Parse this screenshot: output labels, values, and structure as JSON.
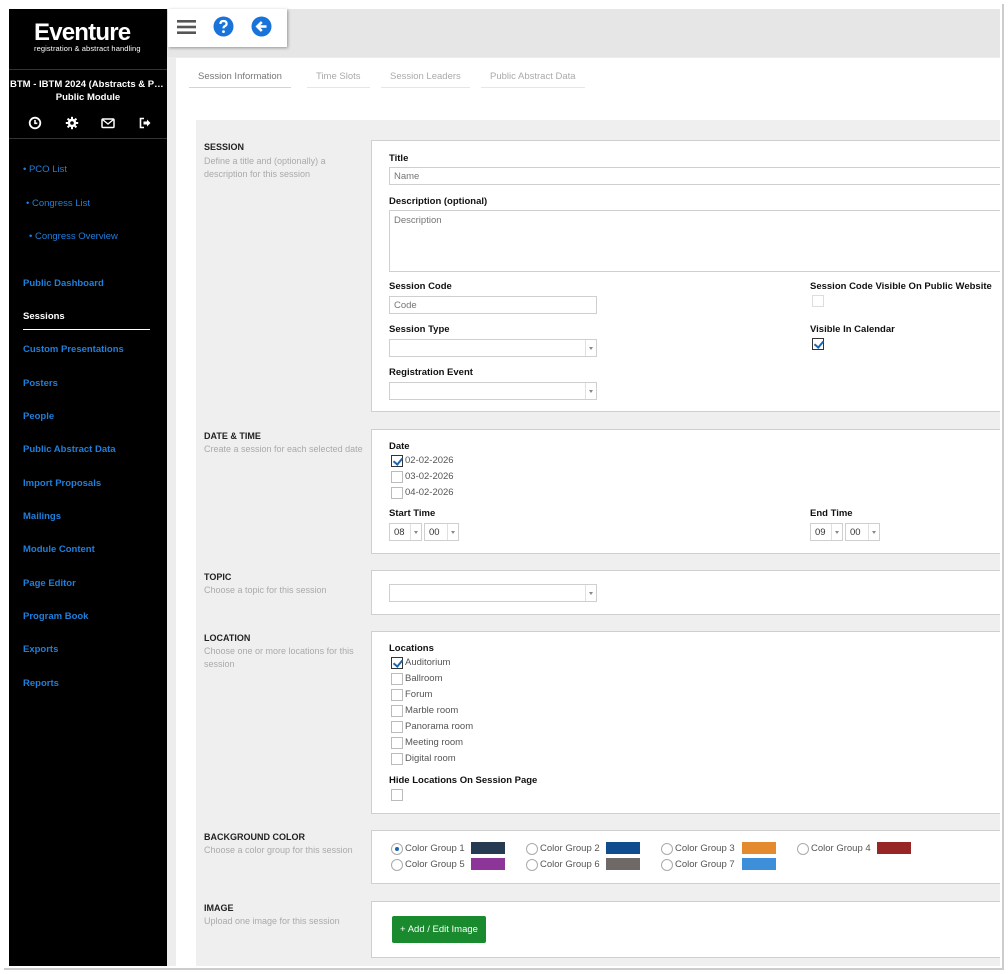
{
  "sidebar": {
    "brand": "Eventure",
    "tagline": "registration & abstract handling",
    "event_title": "BTM - IBTM 2024 (Abstracts & Par...",
    "module": "Public Module",
    "icons": [
      "clock-icon",
      "gear-icon",
      "envelope-icon",
      "logout-icon"
    ],
    "nav": [
      {
        "label": "• PCO List",
        "type": "sub"
      },
      {
        "label": "• Congress List",
        "type": "sub"
      },
      {
        "label": "• Congress Overview",
        "type": "sub"
      },
      {
        "label": "Public Dashboard",
        "type": "main"
      },
      {
        "label": "Sessions",
        "type": "active"
      },
      {
        "label": "Custom Presentations",
        "type": "main"
      },
      {
        "label": "Posters",
        "type": "main"
      },
      {
        "label": "People",
        "type": "main"
      },
      {
        "label": "Public Abstract Data",
        "type": "main"
      },
      {
        "label": "Import Proposals",
        "type": "main"
      },
      {
        "label": "Mailings",
        "type": "main"
      },
      {
        "label": "Module Content",
        "type": "main"
      },
      {
        "label": "Page Editor",
        "type": "main"
      },
      {
        "label": "Program Book",
        "type": "main"
      },
      {
        "label": "Exports",
        "type": "main"
      },
      {
        "label": "Reports",
        "type": "main"
      }
    ]
  },
  "toolbar": {
    "icons": [
      "menu-icon",
      "help-icon",
      "back-icon"
    ],
    "accent": "#1a73d9"
  },
  "tabs": [
    "Session Information",
    "Time Slots",
    "Session Leaders",
    "Public Abstract Data"
  ],
  "session": {
    "title": "SESSION",
    "desc": "Define a title and (optionally) a description for this session",
    "title_label": "Title",
    "title_placeholder": "Name",
    "description_label": "Description (optional)",
    "description_placeholder": "Description",
    "code_label": "Session Code",
    "code_placeholder": "Code",
    "code_visible_label": "Session Code Visible On Public Website",
    "code_visible": false,
    "type_label": "Session Type",
    "type_value": "",
    "calendar_label": "Visible In Calendar",
    "calendar_visible": true,
    "reg_event_label": "Registration Event",
    "reg_event_value": ""
  },
  "datetime": {
    "title": "DATE & TIME",
    "desc": "Create a session for each selected date",
    "date_label": "Date",
    "dates": [
      {
        "label": "02-02-2026",
        "checked": true
      },
      {
        "label": "03-02-2026",
        "checked": false
      },
      {
        "label": "04-02-2026",
        "checked": false
      }
    ],
    "start_label": "Start Time",
    "start_hour": "08",
    "start_min": "00",
    "end_label": "End Time",
    "end_hour": "09",
    "end_min": "00"
  },
  "topic": {
    "title": "TOPIC",
    "desc": "Choose a topic for this session",
    "value": ""
  },
  "location": {
    "title": "LOCATION",
    "desc": "Choose one or more locations for this session",
    "label": "Locations",
    "items": [
      {
        "label": "Auditorium",
        "checked": true
      },
      {
        "label": "Ballroom",
        "checked": false
      },
      {
        "label": "Forum",
        "checked": false
      },
      {
        "label": "Marble room",
        "checked": false
      },
      {
        "label": "Panorama room",
        "checked": false
      },
      {
        "label": "Meeting room",
        "checked": false
      },
      {
        "label": "Digital room",
        "checked": false
      }
    ],
    "hide_label": "Hide Locations On Session Page",
    "hide": false
  },
  "background": {
    "title": "BACKGROUND COLOR",
    "desc": "Choose a color group for this session",
    "selected": 0,
    "groups": [
      {
        "label": "Color Group 1",
        "color": "#263a52"
      },
      {
        "label": "Color Group 2",
        "color": "#0f4d8f"
      },
      {
        "label": "Color Group 3",
        "color": "#e38a2e"
      },
      {
        "label": "Color Group 4",
        "color": "#972726"
      },
      {
        "label": "Color Group 5",
        "color": "#8d3599"
      },
      {
        "label": "Color Group 6",
        "color": "#6e6867"
      },
      {
        "label": "Color Group 7",
        "color": "#3d8fd9"
      }
    ]
  },
  "image": {
    "title": "IMAGE",
    "desc": "Upload one image for this session",
    "button": "+ Add / Edit Image"
  }
}
